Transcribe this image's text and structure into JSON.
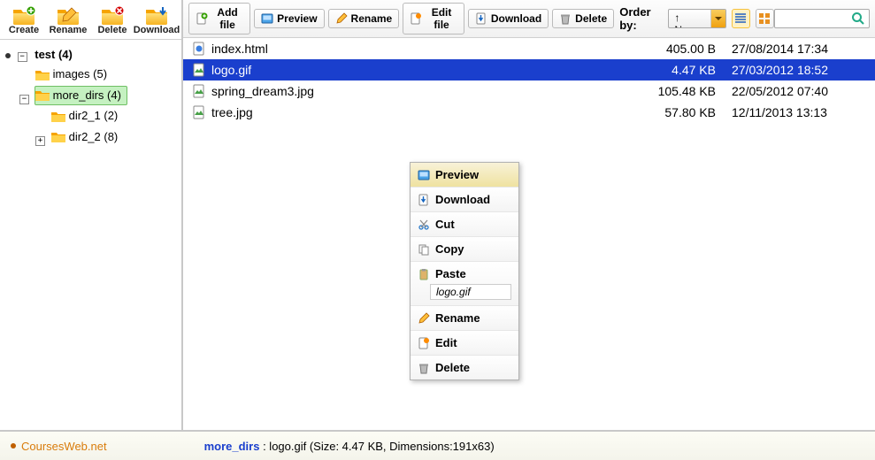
{
  "sidebar_buttons": {
    "create": "Create",
    "rename": "Rename",
    "delete": "Delete",
    "download": "Download"
  },
  "tree": {
    "root": {
      "label": "test (4)",
      "expander": "−"
    },
    "images": {
      "label": "images (5)"
    },
    "more_dirs": {
      "label": "more_dirs (4)",
      "expander": "−"
    },
    "dir2_1": {
      "label": "dir2_1 (2)"
    },
    "dir2_2": {
      "label": "dir2_2 (8)",
      "expander": "+"
    }
  },
  "toolbar": {
    "addfile": "Add file",
    "preview": "Preview",
    "rename": "Rename",
    "editfile": "Edit file",
    "download": "Download",
    "delete": "Delete",
    "orderby": "Order by:",
    "order_value": "↑ Name",
    "search_placeholder": ""
  },
  "files": [
    {
      "name": "index.html",
      "size": "405.00 B",
      "date": "27/08/2014 17:34",
      "kind": "html",
      "selected": false
    },
    {
      "name": "logo.gif",
      "size": "4.47 KB",
      "date": "27/03/2012 18:52",
      "kind": "image",
      "selected": true
    },
    {
      "name": "spring_dream3.jpg",
      "size": "105.48 KB",
      "date": "22/05/2012 07:40",
      "kind": "image",
      "selected": false
    },
    {
      "name": "tree.jpg",
      "size": "57.80 KB",
      "date": "12/11/2013 13:13",
      "kind": "image",
      "selected": false
    }
  ],
  "context_menu": {
    "preview": "Preview",
    "download": "Download",
    "cut": "Cut",
    "copy": "Copy",
    "paste": "Paste",
    "paste_target": "logo.gif",
    "rename": "Rename",
    "edit": "Edit",
    "delete": "Delete"
  },
  "status": {
    "site": "CoursesWeb.net",
    "dir": "more_dirs",
    "tail": " : logo.gif (Size: 4.47 KB, Dimensions:191x63)"
  }
}
